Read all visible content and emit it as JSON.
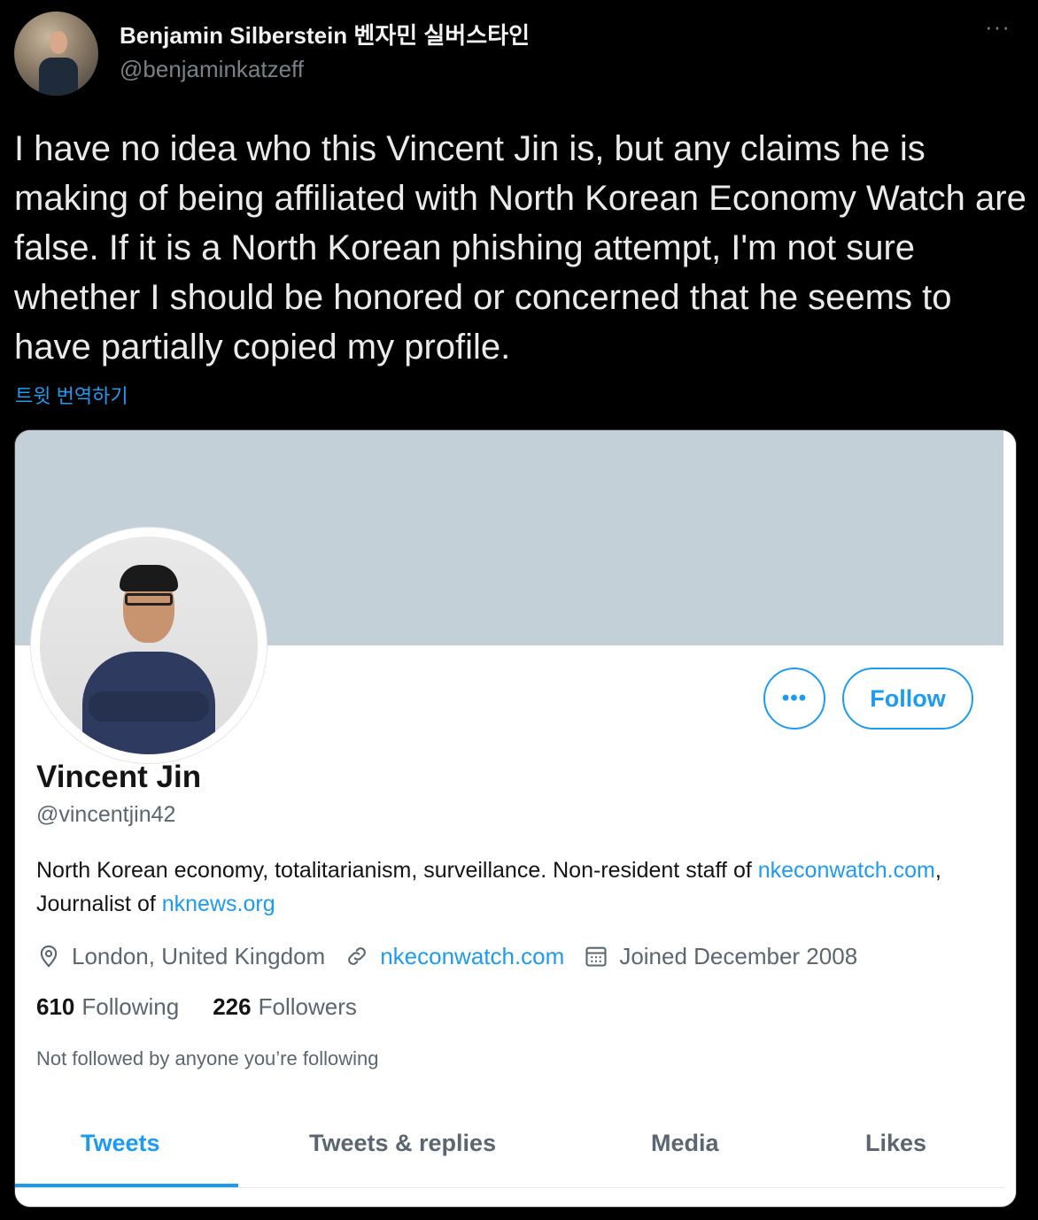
{
  "author": {
    "name": "Benjamin Silberstein 벤자민 실버스타인",
    "handle": "@benjaminkatzeff"
  },
  "tweet": {
    "text": "I have no idea who this Vincent Jin is, but any claims he is making of being affiliated with North Korean Economy Watch are false. If it is a North Korean phishing attempt, I'm not sure whether I should be honored or concerned that he seems to have partially copied my profile.",
    "translate_label": "트윗 번역하기"
  },
  "profile": {
    "follow_label": "Follow",
    "name": "Vincent Jin",
    "handle": "@vincentjin42",
    "bio_text": "North Korean economy, totalitarianism, surveillance. Non-resident staff of ",
    "bio_link1": "nkeconwatch.com",
    "bio_mid": ", Journalist of ",
    "bio_link2": "nknews.org",
    "location": "London, United Kingdom",
    "website": "nkeconwatch.com",
    "joined": "Joined December 2008",
    "following_count": "610",
    "following_label": "Following",
    "followers_count": "226",
    "followers_label": "Followers",
    "not_followed": "Not followed by anyone you’re following",
    "tabs": [
      "Tweets",
      "Tweets & replies",
      "Media",
      "Likes"
    ]
  },
  "colors": {
    "accent": "#1d9bf0",
    "background": "#000000",
    "banner": "#c4d0d7"
  }
}
